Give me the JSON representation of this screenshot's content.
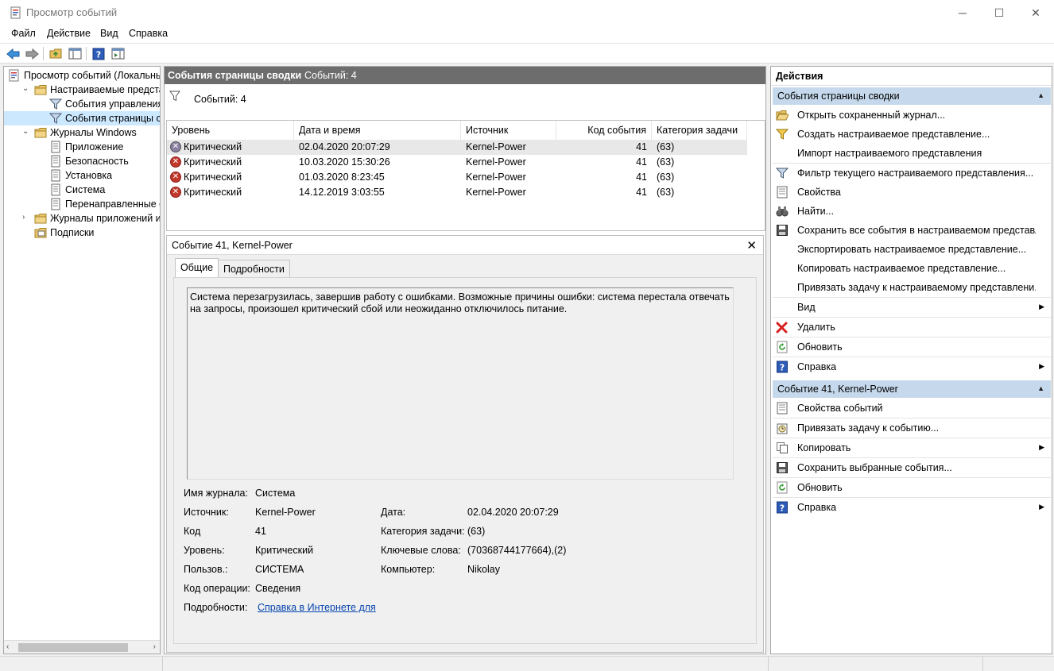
{
  "window": {
    "title": "Просмотр событий",
    "controls": {
      "minimize": "─",
      "maximize": "☐",
      "close": "✕"
    }
  },
  "menu": [
    "Файл",
    "Действие",
    "Вид",
    "Справка"
  ],
  "tree": [
    {
      "label": "Просмотр событий (Локальнь",
      "indent": 0,
      "chevron": "",
      "icon": "event-viewer-icon"
    },
    {
      "label": "Настраиваемые представле",
      "indent": 1,
      "chevron": "⌄",
      "icon": "folder-icon"
    },
    {
      "label": "События управления",
      "indent": 2,
      "chevron": "",
      "icon": "filter-icon"
    },
    {
      "label": "События страницы свод",
      "indent": 2,
      "chevron": "",
      "icon": "filter-icon",
      "selected": true
    },
    {
      "label": "Журналы Windows",
      "indent": 1,
      "chevron": "⌄",
      "icon": "folder-icon"
    },
    {
      "label": "Приложение",
      "indent": 2,
      "chevron": "",
      "icon": "log-icon"
    },
    {
      "label": "Безопасность",
      "indent": 2,
      "chevron": "",
      "icon": "log-icon"
    },
    {
      "label": "Установка",
      "indent": 2,
      "chevron": "",
      "icon": "log-icon"
    },
    {
      "label": "Система",
      "indent": 2,
      "chevron": "",
      "icon": "log-icon"
    },
    {
      "label": "Перенаправленные соб",
      "indent": 2,
      "chevron": "",
      "icon": "log-icon"
    },
    {
      "label": "Журналы приложений и сл",
      "indent": 1,
      "chevron": "›",
      "icon": "folder-icon"
    },
    {
      "label": "Подписки",
      "indent": 1,
      "chevron": "",
      "icon": "subscriptions-icon"
    }
  ],
  "center": {
    "header_title": "События страницы сводки",
    "header_count": "Событий: 4",
    "filter_count": "Событий: 4",
    "columns": [
      "Уровень",
      "Дата и время",
      "Источник",
      "Код события",
      "Категория задачи"
    ],
    "rows": [
      {
        "level": "Критический",
        "datetime": "02.04.2020 20:07:29",
        "source": "Kernel-Power",
        "code": "41",
        "category": "(63)"
      },
      {
        "level": "Критический",
        "datetime": "10.03.2020 15:30:26",
        "source": "Kernel-Power",
        "code": "41",
        "category": "(63)"
      },
      {
        "level": "Критический",
        "datetime": "01.03.2020 8:23:45",
        "source": "Kernel-Power",
        "code": "41",
        "category": "(63)"
      },
      {
        "level": "Критический",
        "datetime": "14.12.2019 3:03:55",
        "source": "Kernel-Power",
        "code": "41",
        "category": "(63)"
      }
    ]
  },
  "detail": {
    "title": "Событие 41, Kernel-Power",
    "close": "✕",
    "tabs": [
      "Общие",
      "Подробности"
    ],
    "description": "Система перезагрузилась, завершив работу с ошибками. Возможные причины ошибки: система перестала отвечать на запросы, произошел критический сбой или неожиданно отключилось питание.",
    "fields": {
      "log_name_label": "Имя журнала:",
      "log_name": "Система",
      "source_label": "Источник:",
      "source": "Kernel-Power",
      "date_label": "Дата:",
      "date": "02.04.2020 20:07:29",
      "code_label": "Код",
      "code": "41",
      "task_label": "Категория задачи:",
      "task": "(63)",
      "level_label": "Уровень:",
      "level": "Критический",
      "keywords_label": "Ключевые слова:",
      "keywords": "(70368744177664),(2)",
      "user_label": "Пользов.:",
      "user": "СИСТЕМА",
      "computer_label": "Компьютер:",
      "computer": "Nikolay",
      "opcode_label": "Код операции:",
      "opcode": "Сведения",
      "more_label": "Подробности:",
      "more_link": "Справка в Интернете для "
    }
  },
  "actions": {
    "title": "Действия",
    "section1": "События страницы сводки",
    "section1_items": [
      {
        "label": "Открыть сохраненный журнал...",
        "icon": "open-folder-icon"
      },
      {
        "label": "Создать настраиваемое представление...",
        "icon": "create-filter-icon"
      },
      {
        "label": "Импорт настраиваемого представления",
        "icon": ""
      },
      {
        "label": "Фильтр текущего настраиваемого представления...",
        "icon": "filter-icon"
      },
      {
        "label": "Свойства",
        "icon": "properties-icon"
      },
      {
        "label": "Найти...",
        "icon": "binoculars-icon"
      },
      {
        "label": "Сохранить все события в настраиваемом представл...",
        "icon": "save-icon"
      },
      {
        "label": "Экспортировать настраиваемое представление...",
        "icon": ""
      },
      {
        "label": "Копировать настраиваемое представление...",
        "icon": ""
      },
      {
        "label": "Привязать задачу к настраиваемому представлени...",
        "icon": ""
      },
      {
        "label": "Вид",
        "icon": "",
        "submenu": true
      },
      {
        "label": "Удалить",
        "icon": "delete-icon"
      },
      {
        "label": "Обновить",
        "icon": "refresh-icon"
      },
      {
        "label": "Справка",
        "icon": "help-icon",
        "submenu": true
      }
    ],
    "section2": "Событие 41, Kernel-Power",
    "section2_items": [
      {
        "label": "Свойства событий",
        "icon": "properties-icon"
      },
      {
        "label": "Привязать задачу к событию...",
        "icon": "task-icon"
      },
      {
        "label": "Копировать",
        "icon": "copy-icon",
        "submenu": true
      },
      {
        "label": "Сохранить выбранные события...",
        "icon": "save-icon"
      },
      {
        "label": "Обновить",
        "icon": "refresh-icon"
      },
      {
        "label": "Справка",
        "icon": "help-icon",
        "submenu": true
      }
    ]
  },
  "colors": {
    "section_bg": "#c6d9ec",
    "header_bg": "#6d6d6d",
    "error_red": "#c0392b",
    "selection": "#cce8ff",
    "link": "#0645ad"
  }
}
